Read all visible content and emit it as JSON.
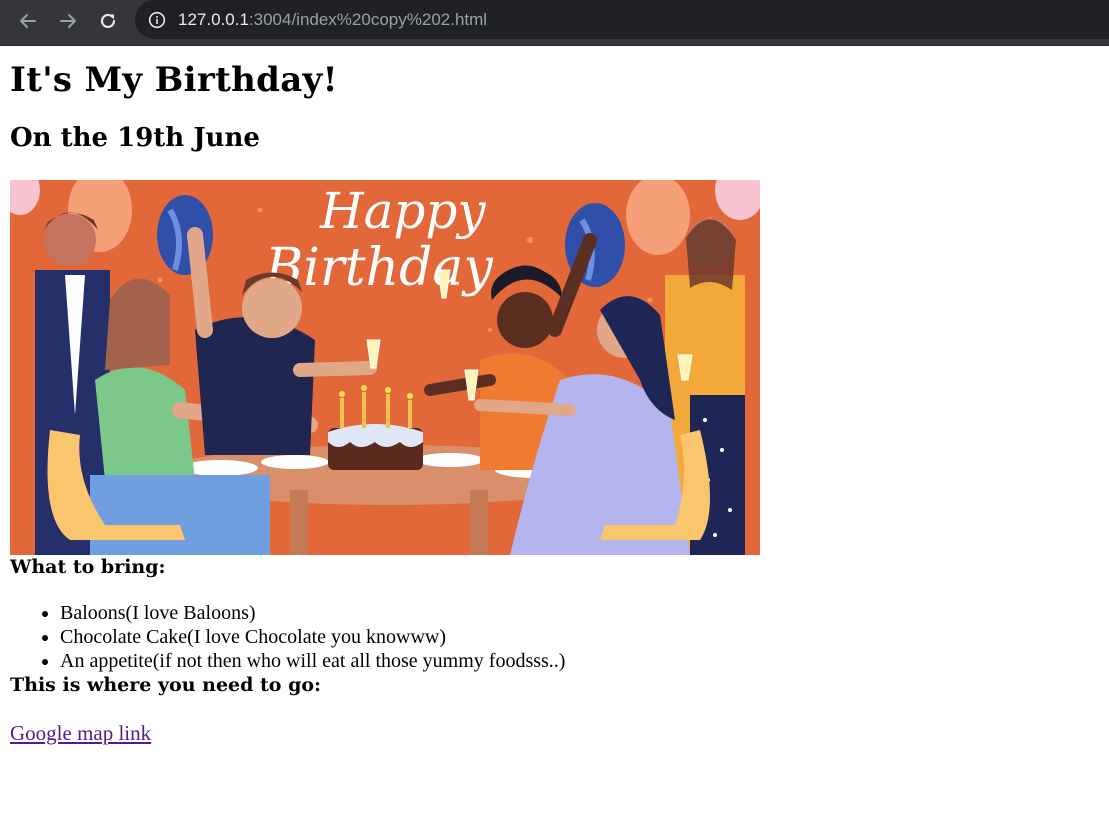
{
  "browser": {
    "url_host": "127.0.0.1",
    "url_rest": ":3004/index%20copy%202.html"
  },
  "page": {
    "title": "It's My Birthday!",
    "subtitle": "On the 19th June",
    "image": {
      "banner_text_line1": "Happy",
      "banner_text_line2": "Birthday"
    },
    "bring_heading": "What to bring:",
    "bring_items": [
      "Baloons(I love Baloons)",
      "Chocolate Cake(I love Chocolate you knowww)",
      "An appetite(if not then who will eat all those yummy foodsss..)"
    ],
    "where_heading": "This is where you need to go:",
    "map_link_text": "Google map link"
  },
  "colors": {
    "toolbar": "#35363a",
    "omnibox": "#202124",
    "link_visited": "#551a8b",
    "hero_background": "#e2683a"
  }
}
